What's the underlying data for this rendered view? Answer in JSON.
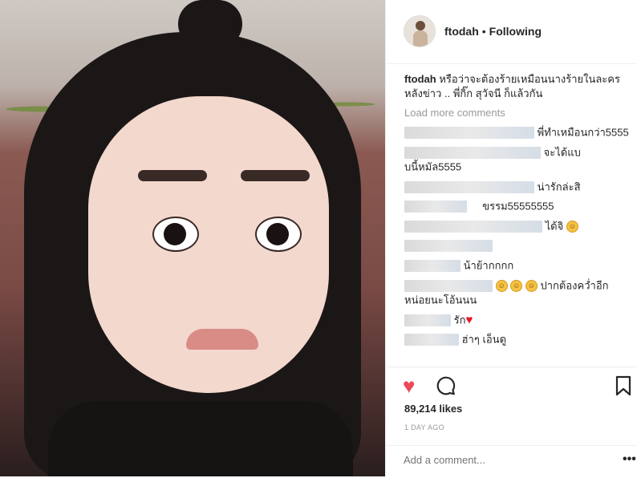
{
  "post": {
    "username": "ftodah",
    "separator": "•",
    "follow_status": "Following"
  },
  "caption": {
    "user": "ftodah",
    "text": "หรือว่าจะต้องร้ายเหมือนนางร้ายในละครหลังข่าว .. พี่กิ๊ก สุวัจนี ก็แล้วกัน"
  },
  "load_more": "Load more comments",
  "comments": [
    {
      "text": "พี่ทำเหมือนกว่า5555"
    },
    {
      "text": "จะได้แบบนี้หมัล5555"
    },
    {
      "text": "น่ารักล่ะสิ"
    },
    {
      "text": "ขรรม55555555"
    },
    {
      "text": "ได้จิ"
    },
    {
      "text": ""
    },
    {
      "text": "น้าย้ากกกก"
    },
    {
      "text": "ปากต้องคว่ำอีกหน่อยนะโอ้นนน"
    },
    {
      "text": "รัก"
    },
    {
      "text": "ฮ่าๆ เอ็นดู"
    }
  ],
  "likes": "89,214 likes",
  "timestamp": "1 DAY AGO",
  "add_comment_placeholder": "Add a comment...",
  "more_options": "•••",
  "icons": {
    "heart": "heart-filled-icon",
    "comment": "comment-bubble-icon",
    "bookmark": "bookmark-icon",
    "emoji_grin": "grinning-emoji-icon",
    "emoji_sweat": "sweat-smile-emoji-icon",
    "heart_small": "red-heart-emoji-icon"
  },
  "colors": {
    "like_red": "#ed4956",
    "muted_text": "#999999",
    "divider": "#efefef"
  }
}
